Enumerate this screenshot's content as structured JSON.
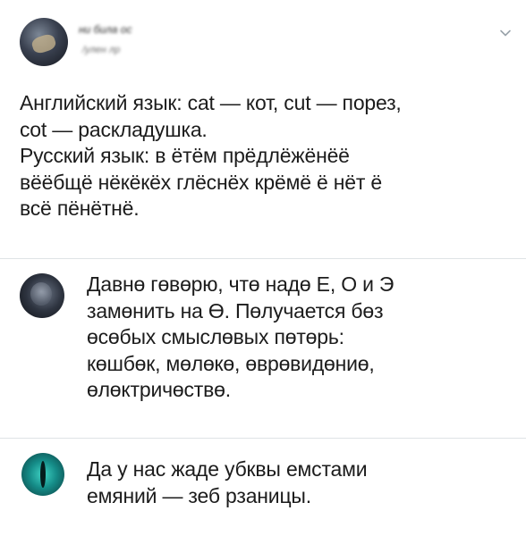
{
  "post": {
    "author_name": "ни била ос",
    "author_handle": "/улен лр",
    "text_lines": [
      "Английский язык: cat — кот, cut — порез,",
      "cot — раскладушка.",
      "Русский язык: в ётём прёдлёжёнёё",
      "вёёбщё нёкёкёх глёснёх крёмё ё нёт ё",
      "всё пёнётнё."
    ]
  },
  "replies": [
    {
      "text_lines": [
        "Давнө гөвөрю, чтө надө Е, О и Э",
        "замөнить на Ө. Пөлучается бөз",
        "өсөбых смыслөвых пөтөрь:",
        "көшбөк, мөлөкө, өврөвидөниө,",
        "өлөктричөствө."
      ]
    },
    {
      "text_lines": [
        "Да у нас жаде убквы емстами",
        "емяний — зеб рзаницы."
      ]
    }
  ],
  "icons": {
    "menu": "chevron-down-icon"
  },
  "colors": {
    "text": "#1c1c1c",
    "divider": "#dfe3e6",
    "chevron": "#9aa3ab"
  }
}
